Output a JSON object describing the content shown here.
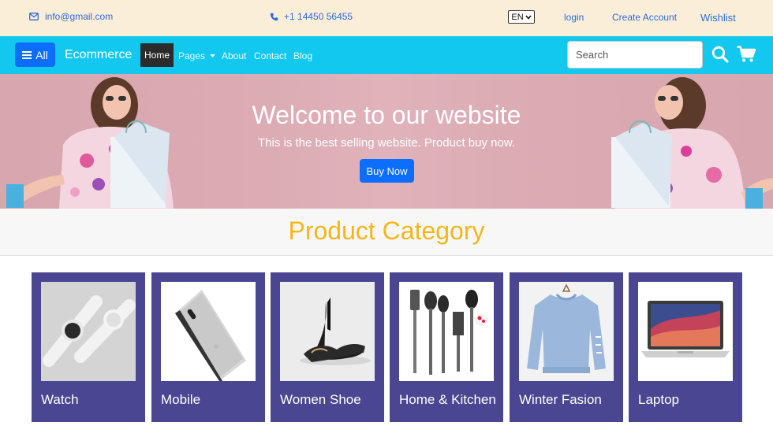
{
  "topbar": {
    "email": "info@gmail.com",
    "phone": "+1 14450 56455",
    "language": "EN",
    "login": "login",
    "create_account": "Create Account",
    "wishlist": "Wishlist"
  },
  "navbar": {
    "all_label": "All",
    "brand": "Ecommerce",
    "links": [
      "Home",
      "Pages",
      "About",
      "Contact",
      "Blog"
    ],
    "search_placeholder": "Search",
    "color": "#12c8ef"
  },
  "hero": {
    "title": "Welcome to our website",
    "subtitle": "This is the best selling website. Product buy now.",
    "button": "Buy Now"
  },
  "category": {
    "title": "Product Category",
    "items": [
      {
        "label": "Watch",
        "icon": "smartwatch-image"
      },
      {
        "label": "Mobile",
        "icon": "smartphone-image"
      },
      {
        "label": "Women Shoe",
        "icon": "heels-image"
      },
      {
        "label": "Home & Kitchen",
        "icon": "utensils-image"
      },
      {
        "label": "Winter Fasion",
        "icon": "sweater-image"
      },
      {
        "label": "Laptop",
        "icon": "laptop-image"
      }
    ]
  },
  "colors": {
    "accent": "#0d6efd",
    "card": "#4a4691",
    "heading": "#f5b61a",
    "topbar": "#fbeed9"
  }
}
